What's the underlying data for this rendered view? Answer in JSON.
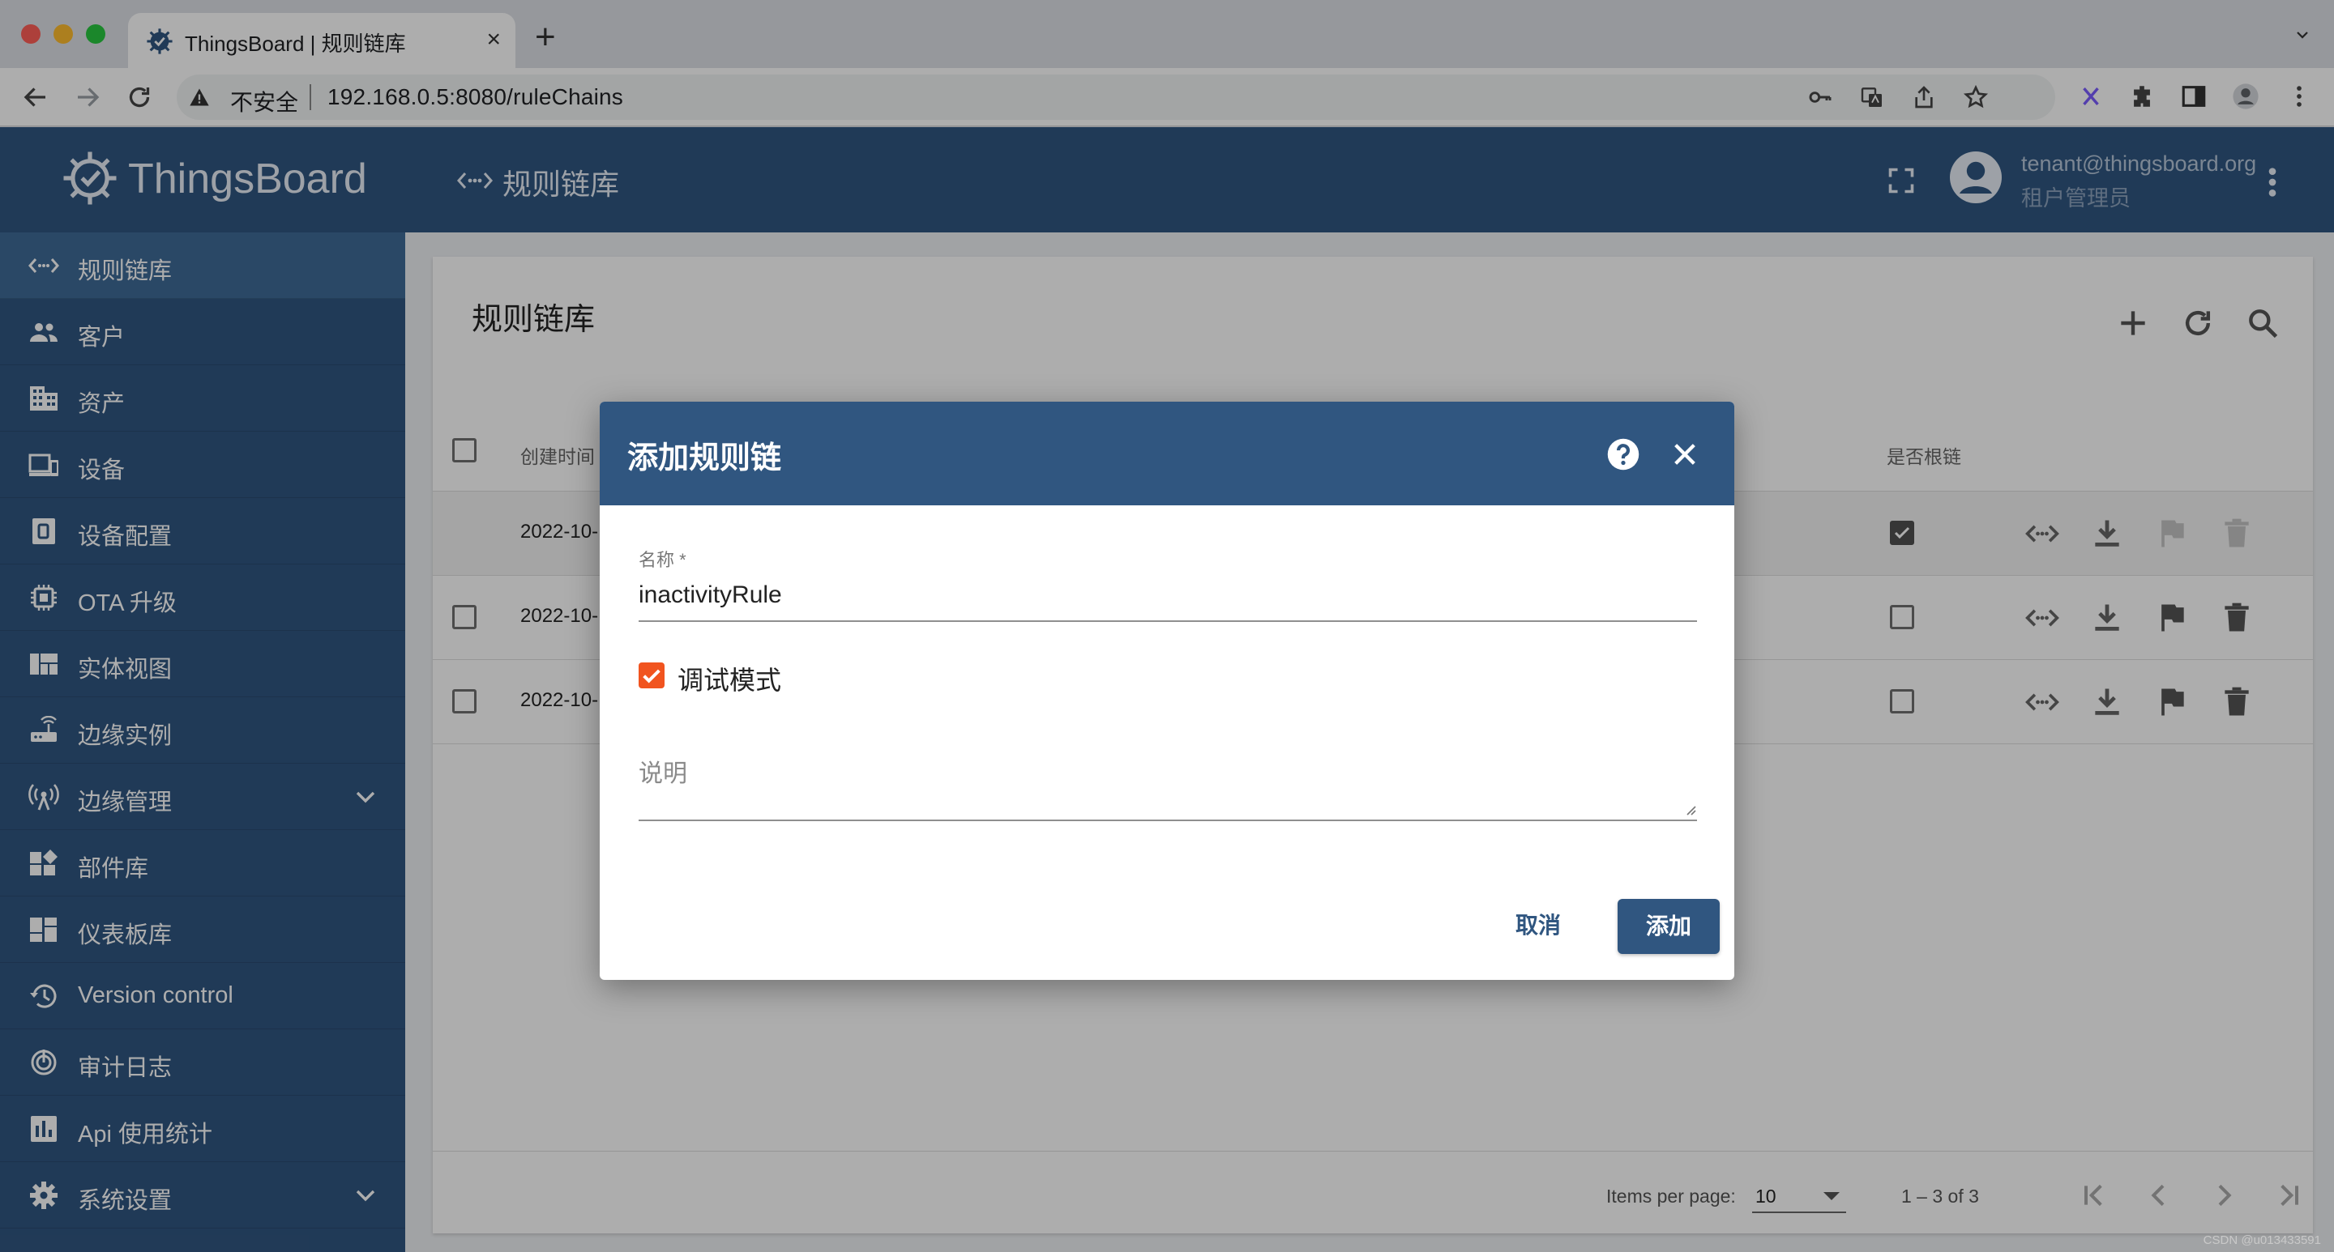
{
  "browser": {
    "tab_title": "ThingsBoard | 规则链库",
    "new_tab": "+",
    "tab_close": "×",
    "insecure_label": "不安全",
    "url": "192.168.0.5:8080/ruleChains"
  },
  "app": {
    "logo_text": "ThingsBoard",
    "page_title": "规则链库",
    "user_email": "tenant@thingsboard.org",
    "user_role": "租户管理员"
  },
  "sidebar": {
    "items": [
      {
        "label": "规则链库",
        "icon": "rule-chain-icon"
      },
      {
        "label": "客户",
        "icon": "people-icon"
      },
      {
        "label": "资产",
        "icon": "building-icon"
      },
      {
        "label": "设备",
        "icon": "devices-icon"
      },
      {
        "label": "设备配置",
        "icon": "device-profile-icon"
      },
      {
        "label": "OTA 升级",
        "icon": "chip-icon"
      },
      {
        "label": "实体视图",
        "icon": "view-quilt-icon"
      },
      {
        "label": "边缘实例",
        "icon": "router-icon"
      },
      {
        "label": "边缘管理",
        "icon": "antenna-icon"
      },
      {
        "label": "部件库",
        "icon": "widgets-icon"
      },
      {
        "label": "仪表板库",
        "icon": "dashboard-icon"
      },
      {
        "label": "Version control",
        "icon": "history-icon"
      },
      {
        "label": "审计日志",
        "icon": "track-changes-icon"
      },
      {
        "label": "Api 使用统计",
        "icon": "bar-chart-icon"
      },
      {
        "label": "系统设置",
        "icon": "gear-icon"
      }
    ]
  },
  "table": {
    "title": "规则链库",
    "columns": {
      "created": "创建时间",
      "root": "是否根链"
    },
    "rows": [
      {
        "date": "2022-10-",
        "root": true
      },
      {
        "date": "2022-10-",
        "root": false
      },
      {
        "date": "2022-10-",
        "root": false
      }
    ],
    "paginator": {
      "items_per_page_label": "Items per page:",
      "page_size": "10",
      "range": "1 – 3 of 3"
    }
  },
  "dialog": {
    "title": "添加规则链",
    "name_label": "名称 *",
    "name_value": "inactivityRule",
    "debug_label": "调试模式",
    "debug_checked": true,
    "description_placeholder": "说明",
    "cancel_label": "取消",
    "add_label": "添加"
  },
  "colors": {
    "primary": "#305680",
    "accent": "#f1541f"
  },
  "watermark": "CSDN @u013433591"
}
